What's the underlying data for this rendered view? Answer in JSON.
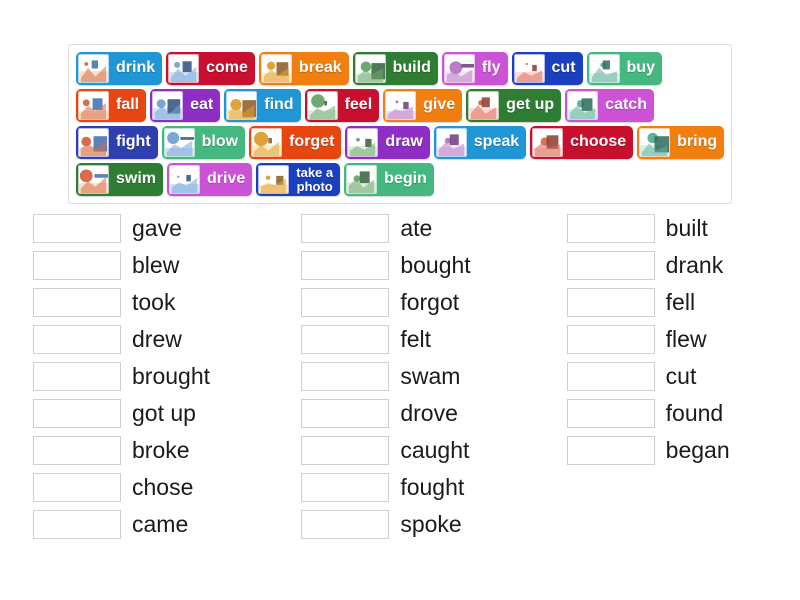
{
  "tile_bank": {
    "rows": [
      [
        {
          "label": "drink",
          "color": "#2196d6",
          "icon": "girl-drinking-icon"
        },
        {
          "label": "come",
          "color": "#c8102e",
          "icon": "people-coming-icon"
        },
        {
          "label": "break",
          "color": "#f07f0f",
          "icon": "breaking-object-icon"
        },
        {
          "label": "build",
          "color": "#2e7d32",
          "icon": "bricklaying-icon"
        },
        {
          "label": "fly",
          "color": "#cc52d6",
          "icon": "flying-birds-icon"
        },
        {
          "label": "cut",
          "color": "#1a3fbf",
          "icon": "cutting-paper-icon"
        },
        {
          "label": "buy",
          "color": "#45b882",
          "icon": "shopping-icon"
        }
      ],
      [
        {
          "label": "fall",
          "color": "#e84610",
          "icon": "person-falling-icon"
        },
        {
          "label": "eat",
          "color": "#8e2ec4",
          "icon": "girl-eating-icon"
        },
        {
          "label": "find",
          "color": "#2196d6",
          "icon": "finding-icon"
        },
        {
          "label": "feel",
          "color": "#c8102e",
          "icon": "emotion-faces-icon"
        },
        {
          "label": "give",
          "color": "#f07f0f",
          "icon": "giving-gift-icon"
        },
        {
          "label": "get up",
          "color": "#2e7d32",
          "icon": "waking-up-icon"
        },
        {
          "label": "catch",
          "color": "#cc52d6",
          "icon": "catching-ball-icon"
        }
      ],
      [
        {
          "label": "fight",
          "color": "#2f3fb0",
          "icon": "fighting-icon"
        },
        {
          "label": "blow",
          "color": "#45b882",
          "icon": "blowing-bubbles-icon"
        },
        {
          "label": "forget",
          "color": "#e84610",
          "icon": "forgetting-icon"
        },
        {
          "label": "draw",
          "color": "#8e2ec4",
          "icon": "drawing-icon"
        },
        {
          "label": "speak",
          "color": "#2196d6",
          "icon": "speaking-icon"
        },
        {
          "label": "choose",
          "color": "#c8102e",
          "icon": "choosing-door-icon"
        },
        {
          "label": "bring",
          "color": "#f07f0f",
          "icon": "bringing-icon"
        }
      ],
      [
        {
          "label": "swim",
          "color": "#2e7d32",
          "icon": "swimming-icon"
        },
        {
          "label": "drive",
          "color": "#cc52d6",
          "icon": "red-car-icon"
        },
        {
          "label": "take a\nphoto",
          "color": "#1a3fbf",
          "icon": "camera-photographer-icon",
          "two_line": true
        },
        {
          "label": "begin",
          "color": "#45b882",
          "icon": "race-start-icon"
        }
      ]
    ]
  },
  "answers": {
    "columns": [
      {
        "items": [
          "gave",
          "blew",
          "took",
          "drew",
          "brought",
          "got up",
          "broke",
          "chose",
          "came"
        ]
      },
      {
        "items": [
          "ate",
          "bought",
          "forgot",
          "felt",
          "swam",
          "drove",
          "caught",
          "fought",
          "spoke"
        ]
      },
      {
        "items": [
          "built",
          "drank",
          "fell",
          "flew",
          "cut",
          "found",
          "began"
        ]
      }
    ]
  }
}
